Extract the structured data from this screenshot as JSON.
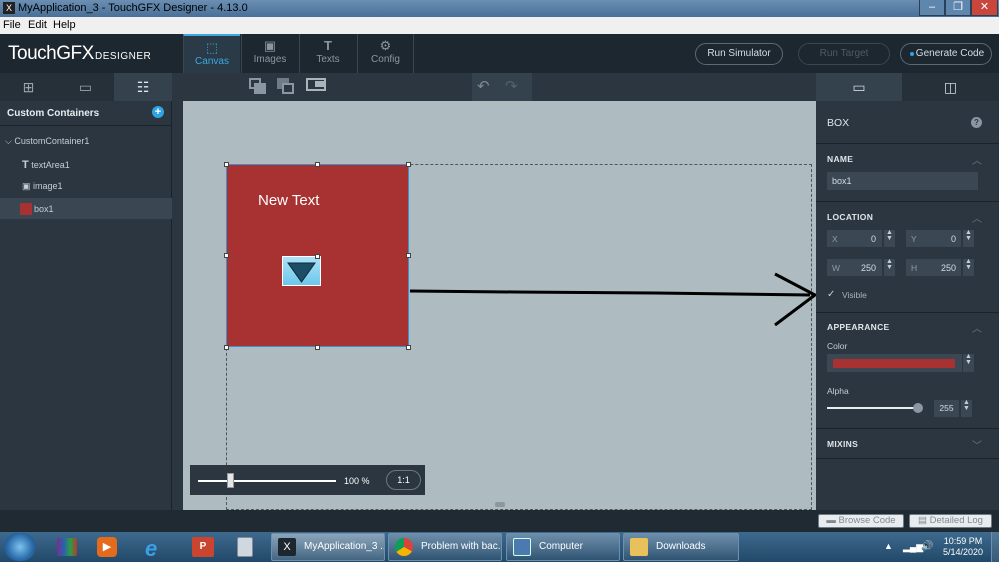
{
  "window": {
    "title": "MyApplication_3 - TouchGFX Designer - 4.13.0"
  },
  "menu": [
    "File",
    "Edit",
    "Help"
  ],
  "header": {
    "logo": "TouchGFX",
    "logo_sub": "DESIGNER",
    "tabs": [
      {
        "label": "Canvas",
        "icon": "canvas-icon",
        "active": true
      },
      {
        "label": "Images",
        "icon": "image-icon",
        "active": false
      },
      {
        "label": "Texts",
        "icon": "text-icon",
        "active": false
      },
      {
        "label": "Config",
        "icon": "gear-icon",
        "active": false
      }
    ],
    "run_simulator": "Run Simulator",
    "run_target": "Run Target",
    "generate_code": "Generate Code"
  },
  "left_panel": {
    "title": "Custom Containers",
    "tree": [
      {
        "label": "CustomContainer1",
        "icon": "chevron-down-icon"
      },
      {
        "label": "textArea1",
        "icon": "text-icon"
      },
      {
        "label": "image1",
        "icon": "image-icon"
      },
      {
        "label": "box1",
        "icon": "box-icon",
        "selected": true
      }
    ]
  },
  "canvas": {
    "box_text": "New Text",
    "zoom_percent": "100 %",
    "zoom_reset": "1:1",
    "zoom_level": 100,
    "box_color": "#a83232"
  },
  "properties": {
    "widget_type": "BOX",
    "name_section": "NAME",
    "name_value": "box1",
    "location_section": "LOCATION",
    "x_label": "X",
    "x_value": "0",
    "y_label": "Y",
    "y_value": "0",
    "w_label": "W",
    "w_value": "250",
    "h_label": "H",
    "h_value": "250",
    "visible_label": "Visible",
    "appearance_section": "APPEARANCE",
    "color_label": "Color",
    "color_value": "#a83232",
    "alpha_label": "Alpha",
    "alpha_value": "255",
    "alpha_level": 255,
    "mixins_section": "MIXINS"
  },
  "bottom": {
    "browse_code": "Browse Code",
    "detailed_log": "Detailed Log"
  },
  "taskbar": {
    "tasks": [
      {
        "label": "MyApplication_3 ...",
        "icon": "touchgfx-icon"
      },
      {
        "label": "Problem with bac...",
        "icon": "chrome-icon"
      },
      {
        "label": "Computer",
        "icon": "computer-icon"
      },
      {
        "label": "Downloads",
        "icon": "folder-icon"
      }
    ],
    "time": "10:59 PM",
    "date": "5/14/2020"
  }
}
